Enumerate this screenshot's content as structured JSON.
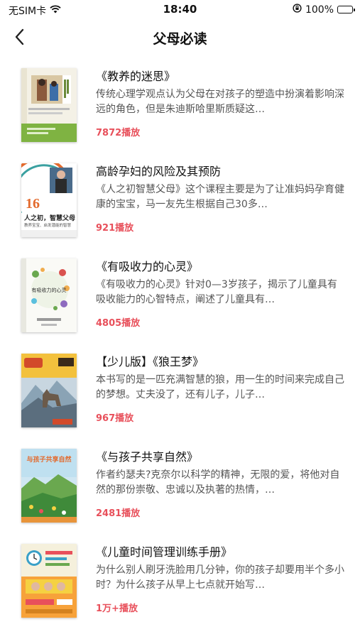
{
  "status_bar": {
    "carrier": "无SIM卡",
    "time": "18:40",
    "battery": "100%"
  },
  "nav": {
    "title": "父母必读"
  },
  "items": [
    {
      "title": "《教养的迷思》",
      "desc": "传统心理学观点认为父母在对孩子的塑造中扮演着影响深远的角色，但是朱迪斯哈里斯质疑这…",
      "plays": "7872播放",
      "cover_icon": "book-cover-parenting-myth"
    },
    {
      "title": "高龄孕妇的风险及其预防",
      "desc": "《人之初智慧父母》这个课程主要是为了让准妈妈孕育健康的宝宝，马一友先生根据自己30多…",
      "plays": "921播放",
      "cover_icon": "book-cover-wise-parents",
      "cover_text": {
        "num": "16",
        "line1": "人之初，智慧父母",
        "line2": "教养宝宝、启发潜能的智慧"
      }
    },
    {
      "title": "《有吸收力的心灵》",
      "desc": "《有吸收力的心灵》针对0—3岁孩子，揭示了儿童具有吸收能力的心智特点，阐述了儿童具有…",
      "plays": "4805播放",
      "cover_icon": "book-cover-absorbent-mind",
      "cover_text": {
        "title": "有吸收力的心灵"
      }
    },
    {
      "title": "【少儿版】《狼王梦》",
      "desc": "本书写的是一匹充满智慧的狼，用一生的时间来完成自己的梦想。丈夫没了，还有儿子，儿子…",
      "plays": "967播放",
      "cover_icon": "book-cover-wolf-king"
    },
    {
      "title": "《与孩子共享自然》",
      "desc": "作者约瑟夫?克奈尔以科学的精神，无限的爱，将他对自然的那份崇敬、忠诚以及执著的热情，…",
      "plays": "2481播放",
      "cover_icon": "book-cover-share-nature",
      "cover_text": {
        "title": "与孩子共享自然"
      }
    },
    {
      "title": "《儿童时间管理训练手册》",
      "desc": "为什么别人刷牙洗脸用几分钟，你的孩子却要用半个多小时？为什么孩子从早上七点就开始写…",
      "plays": "1万+播放",
      "cover_icon": "book-cover-time-management"
    }
  ],
  "colors": {
    "accent": "#e8505b",
    "title": "#111111",
    "desc": "#555555"
  }
}
